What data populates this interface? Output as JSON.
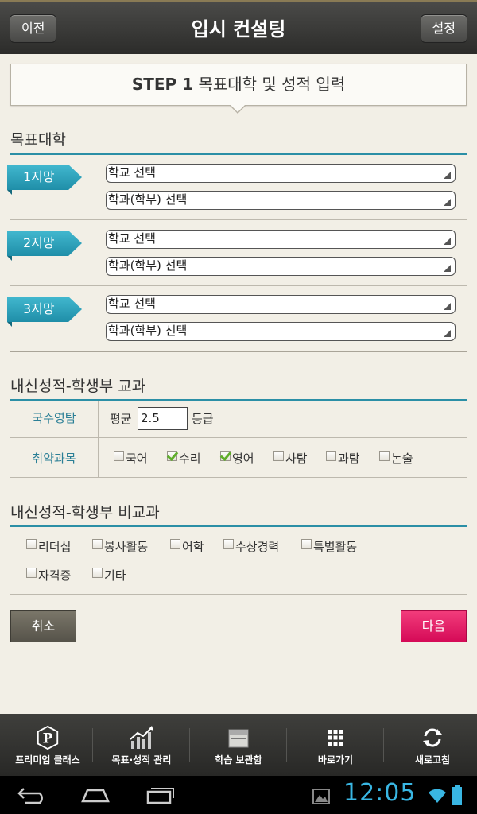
{
  "header": {
    "title": "입시 컨설팅",
    "back_label": "이전",
    "settings_label": "설정"
  },
  "step": {
    "prefix": "STEP 1",
    "text": "목표대학 및 성적 입력"
  },
  "target": {
    "section_title": "목표대학",
    "choices": [
      {
        "label": "1지망",
        "school_placeholder": "학교 선택",
        "dept_placeholder": "학과(학부) 선택"
      },
      {
        "label": "2지망",
        "school_placeholder": "학교 선택",
        "dept_placeholder": "학과(학부) 선택"
      },
      {
        "label": "3지망",
        "school_placeholder": "학교 선택",
        "dept_placeholder": "학과(학부) 선택"
      }
    ]
  },
  "grades": {
    "section_title": "내신성적-학생부 교과",
    "row1_label": "국수영탐",
    "average_label": "평균",
    "average_value": "2.5",
    "unit": "등급",
    "row2_label": "취약과목",
    "subjects": [
      {
        "label": "국어",
        "checked": false
      },
      {
        "label": "수리",
        "checked": true
      },
      {
        "label": "영어",
        "checked": true
      },
      {
        "label": "사탐",
        "checked": false
      },
      {
        "label": "과탐",
        "checked": false
      },
      {
        "label": "논술",
        "checked": false
      }
    ]
  },
  "extra": {
    "section_title": "내신성적-학생부 비교과",
    "items": [
      {
        "label": "리더십",
        "checked": false
      },
      {
        "label": "봉사활동",
        "checked": false
      },
      {
        "label": "어학",
        "checked": false
      },
      {
        "label": "수상경력",
        "checked": false
      },
      {
        "label": "특별활동",
        "checked": false
      },
      {
        "label": "자격증",
        "checked": false
      },
      {
        "label": "기타",
        "checked": false
      }
    ]
  },
  "actions": {
    "cancel_label": "취소",
    "next_label": "다음"
  },
  "bottom_nav": [
    {
      "label": "프리미엄 클래스",
      "icon": "premium-logo-icon"
    },
    {
      "label": "목표·성적 관리",
      "icon": "chart-icon"
    },
    {
      "label": "학습 보관함",
      "icon": "folder-icon"
    },
    {
      "label": "바로가기",
      "icon": "grid-icon"
    },
    {
      "label": "새로고침",
      "icon": "refresh-icon"
    }
  ],
  "system": {
    "time": "12:05"
  },
  "colors": {
    "accent_teal": "#2b8fa6",
    "next_pink": "#e3155f",
    "clock_blue": "#39b6e3"
  }
}
